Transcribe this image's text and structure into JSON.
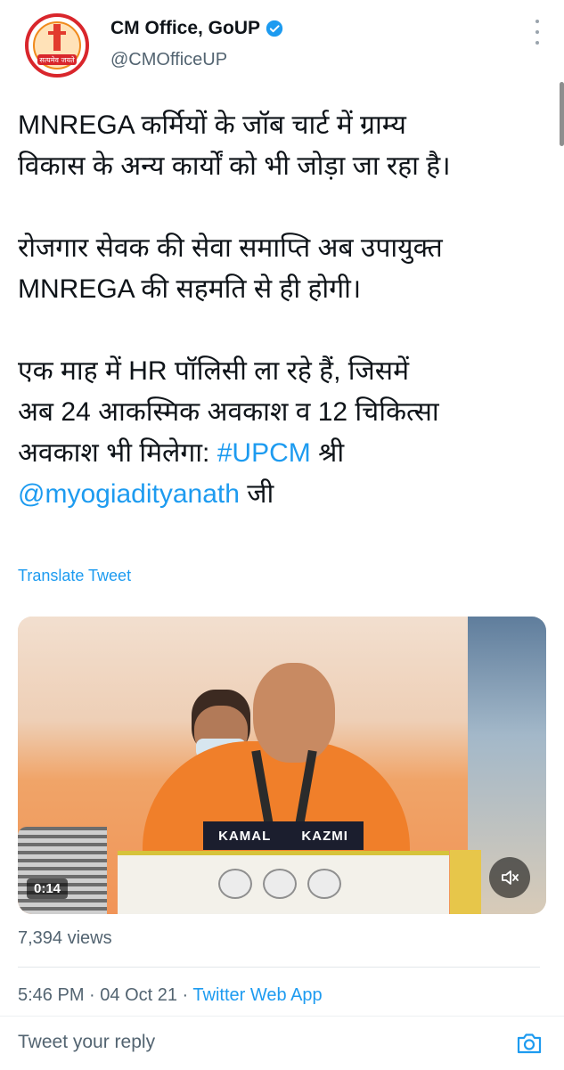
{
  "author": {
    "name": "CM Office, GoUP",
    "handle": "@CMOfficeUP",
    "verified": true,
    "avatar_text": "सत्यमेव जयते"
  },
  "tweet": {
    "paragraphs": [
      {
        "text": "MNREGA कर्मियों के जॉब चार्ट में ग्राम्य\nविकास के अन्य कार्यों को भी जोड़ा जा रहा है।"
      },
      {
        "text": "रोजगार सेवक की सेवा समाप्ति अब उपायुक्त\nMNREGA की सहमति से ही होगी।"
      }
    ],
    "p3_text": "एक माह में HR पॉलिसी ला रहे हैं, जिसमें\nअब 24 आकस्मिक अवकाश व 12 चिकित्सा\nअवकाश भी मिलेगा: ",
    "hashtag": "#UPCM",
    "p3_after_hashtag": " श्री\n",
    "mention": "@myogiadityanath",
    "p3_end": " जी",
    "translate_label": "Translate Tweet"
  },
  "media": {
    "duration": "0:14",
    "podium_left": "KAMAL",
    "podium_right": "KAZMI",
    "mute_icon": "speaker-muted-icon"
  },
  "stats": {
    "views": "7,394 views"
  },
  "meta": {
    "time": "5:46 PM",
    "separator": " · ",
    "date": "04 Oct 21",
    "app": "Twitter Web App"
  },
  "reply": {
    "placeholder": "Tweet your reply",
    "camera_icon": "camera-icon"
  },
  "colors": {
    "link": "#1d9bf0",
    "secondary_text": "#536471",
    "primary_text": "#0f1419"
  }
}
